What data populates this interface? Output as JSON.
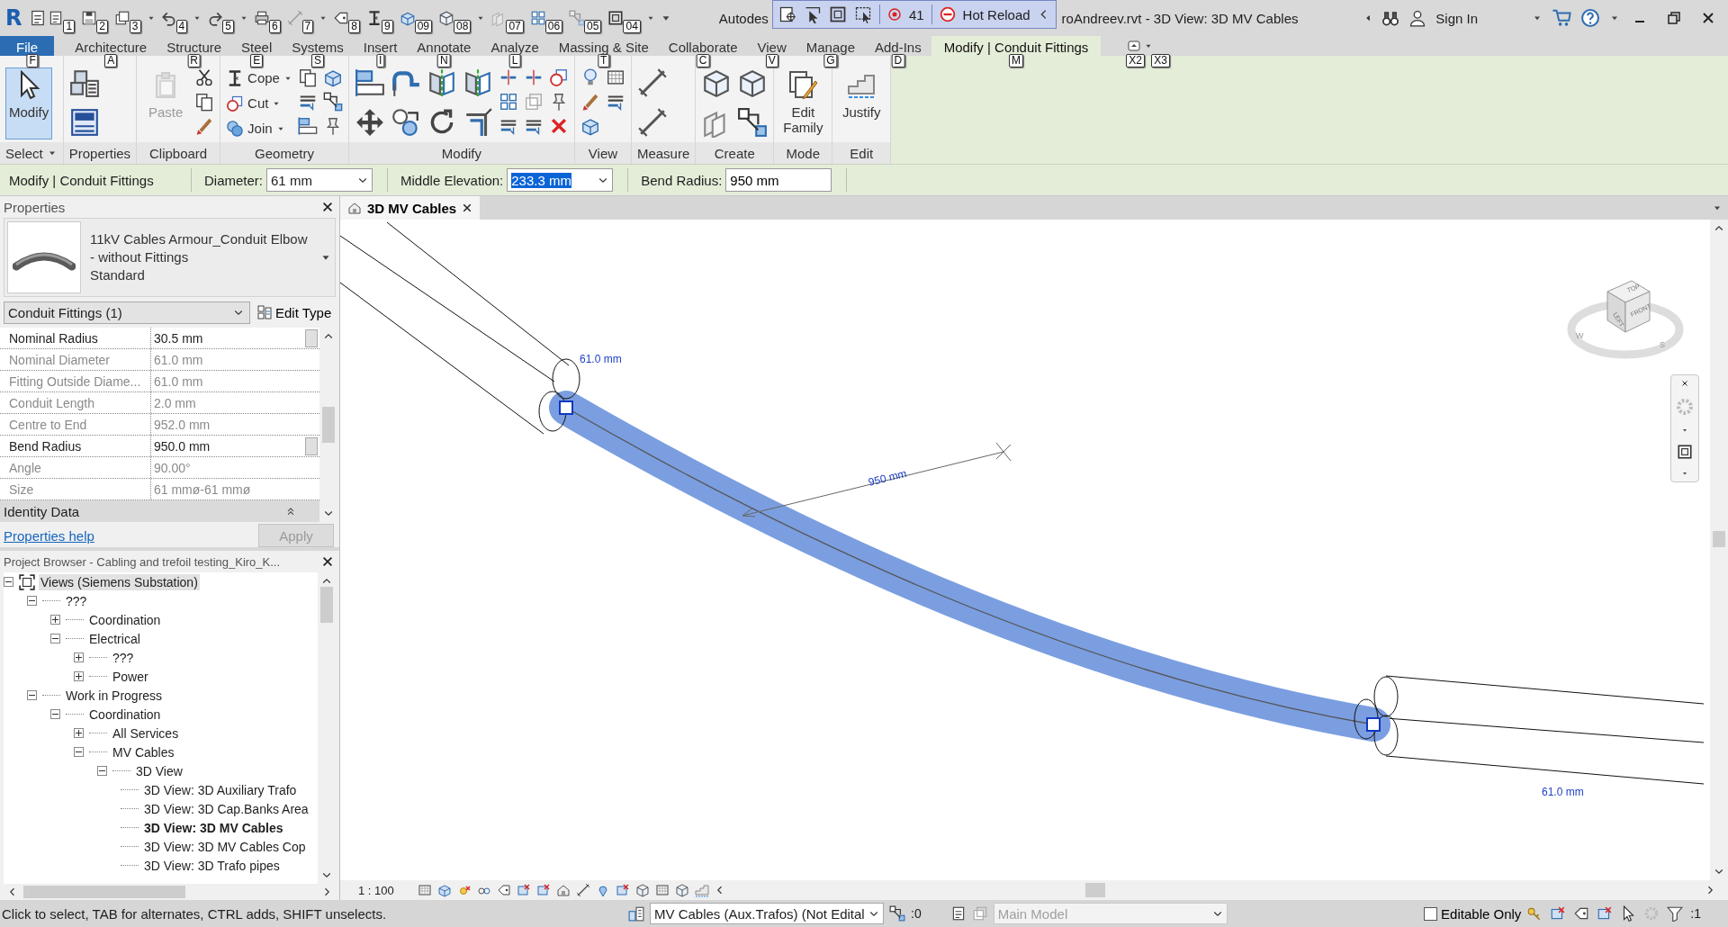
{
  "title_bar": {
    "logo": "R",
    "app_name": "Autodes",
    "file_title": "roAndreev.rvt - 3D View: 3D MV Cables",
    "sign_in": "Sign In"
  },
  "quick_access": [
    {
      "keytip": "1",
      "caret": false,
      "disabled": false
    },
    {
      "keytip": "2",
      "caret": false,
      "disabled": false
    },
    {
      "keytip": "3",
      "caret": true,
      "disabled": false
    },
    {
      "keytip": "4",
      "caret": true,
      "disabled": false
    },
    {
      "keytip": "5",
      "caret": true,
      "disabled": false
    },
    {
      "keytip": "6",
      "caret": false,
      "disabled": false
    },
    {
      "keytip": "7",
      "caret": true,
      "disabled": true
    },
    {
      "keytip": "8",
      "caret": false,
      "disabled": false
    },
    {
      "keytip": "9",
      "caret": false,
      "disabled": false
    },
    {
      "keytip": "09",
      "caret": false,
      "disabled": false
    },
    {
      "keytip": "08",
      "caret": true,
      "disabled": false
    },
    {
      "keytip": "07",
      "caret": false,
      "disabled": true
    },
    {
      "keytip": "06",
      "caret": false,
      "disabled": false
    },
    {
      "keytip": "05",
      "caret": false,
      "disabled": true
    },
    {
      "keytip": "04",
      "caret": true,
      "disabled": false
    }
  ],
  "hot_reload": {
    "count": "41",
    "label": "Hot Reload"
  },
  "ribbon_tabs": [
    {
      "label": "File",
      "keytip": "F",
      "selected": false,
      "kind": "application"
    },
    {
      "label": "Architecture",
      "keytip": "A",
      "selected": false,
      "kind": "tab"
    },
    {
      "label": "Structure",
      "keytip": "R",
      "selected": false,
      "kind": "tab"
    },
    {
      "label": "Steel",
      "keytip": "E",
      "selected": false,
      "kind": "tab"
    },
    {
      "label": "Systems",
      "keytip": "S",
      "selected": false,
      "kind": "tab"
    },
    {
      "label": "Insert",
      "keytip": "I",
      "selected": false,
      "kind": "tab"
    },
    {
      "label": "Annotate",
      "keytip": "N",
      "selected": false,
      "kind": "tab"
    },
    {
      "label": "Analyze",
      "keytip": "L",
      "selected": false,
      "kind": "tab"
    },
    {
      "label": "Massing & Site",
      "keytip": "T",
      "selected": false,
      "kind": "tab"
    },
    {
      "label": "Collaborate",
      "keytip": "C",
      "selected": false,
      "kind": "tab"
    },
    {
      "label": "View",
      "keytip": "V",
      "selected": false,
      "kind": "tab"
    },
    {
      "label": "Manage",
      "keytip": "G",
      "selected": false,
      "kind": "tab"
    },
    {
      "label": "Add-Ins",
      "keytip": "D",
      "selected": false,
      "kind": "tab"
    },
    {
      "label": "Modify | Conduit Fittings",
      "keytip": "M",
      "selected": true,
      "kind": "contextual"
    }
  ],
  "ribbon_keytips": [
    "X2",
    "X3"
  ],
  "ribbon_panels": [
    {
      "title": "Select",
      "has_menu": true,
      "tools": [
        {
          "kind": "large",
          "label": "Modify",
          "selected": true,
          "disabled": false
        }
      ]
    },
    {
      "title": "Properties",
      "has_menu": false
    },
    {
      "title": "Clipboard",
      "has_menu": false,
      "tools": [
        {
          "kind": "large",
          "label": "Paste",
          "selected": false,
          "disabled": true
        }
      ]
    },
    {
      "title": "Geometry",
      "has_menu": false,
      "tools": [
        {
          "kind": "small",
          "label": "Cope"
        },
        {
          "kind": "small",
          "label": "Cut"
        },
        {
          "kind": "small",
          "label": "Join"
        }
      ]
    },
    {
      "title": "Modify",
      "has_menu": false
    },
    {
      "title": "View",
      "has_menu": false
    },
    {
      "title": "Measure",
      "has_menu": false
    },
    {
      "title": "Create",
      "has_menu": false
    },
    {
      "title": "Mode",
      "has_menu": false,
      "tools": [
        {
          "kind": "large",
          "label": "Edit Family",
          "selected": false,
          "disabled": false
        }
      ]
    },
    {
      "title": "Edit",
      "has_menu": false,
      "tools": [
        {
          "kind": "large",
          "label": "Justify",
          "selected": false,
          "disabled": false
        }
      ]
    }
  ],
  "options_bar": {
    "context": "Modify | Conduit Fittings",
    "fields": [
      {
        "label": "Diameter:",
        "value": "61 mm",
        "kind": "combo",
        "highlighted": false
      },
      {
        "label": "Middle Elevation:",
        "value": "233.3 mm",
        "kind": "combo",
        "highlighted": true
      },
      {
        "label": "Bend Radius:",
        "value": "950 mm",
        "kind": "text",
        "highlighted": false
      }
    ]
  },
  "properties": {
    "title": "Properties",
    "type_name": "11kV Cables Armour_Conduit Elbow - without Fittings",
    "type_variant": "Standard",
    "instance_filter": "Conduit Fittings (1)",
    "edit_type": "Edit Type",
    "rows": [
      {
        "name": "Nominal Radius",
        "value": "30.5 mm",
        "disabled": false
      },
      {
        "name": "Nominal Diameter",
        "value": "61.0 mm",
        "disabled": true
      },
      {
        "name": "Fitting Outside Diame...",
        "value": "61.0 mm",
        "disabled": true
      },
      {
        "name": "Conduit Length",
        "value": "2.0 mm",
        "disabled": true
      },
      {
        "name": "Centre to End",
        "value": "952.0 mm",
        "disabled": true
      },
      {
        "name": "Bend Radius",
        "value": "950.0 mm",
        "disabled": false
      },
      {
        "name": "Angle",
        "value": "90.00°",
        "disabled": true
      },
      {
        "name": "Size",
        "value": "61 mmø-61 mmø",
        "disabled": true
      }
    ],
    "group": "Identity Data",
    "help_link": "Properties help",
    "apply": {
      "label": "Apply",
      "disabled": true
    }
  },
  "project_browser": {
    "title": "Project Browser - Cabling and trefoil testing_Kiro_K...",
    "tree": [
      {
        "label": "Views (Siemens Substation)",
        "kind": "root",
        "expanded": true,
        "selected": true,
        "children": [
          {
            "label": "???",
            "kind": "folder",
            "expanded": true,
            "selected": false,
            "children": [
              {
                "label": "Coordination",
                "kind": "folder",
                "expanded": false,
                "selected": false
              },
              {
                "label": "Electrical",
                "kind": "folder",
                "expanded": true,
                "selected": false,
                "children": [
                  {
                    "label": "???",
                    "kind": "folder",
                    "expanded": false,
                    "selected": false
                  },
                  {
                    "label": "Power",
                    "kind": "folder",
                    "expanded": false,
                    "selected": false
                  }
                ]
              }
            ]
          },
          {
            "label": "Work in Progress",
            "kind": "folder",
            "expanded": true,
            "selected": false,
            "children": [
              {
                "label": "Coordination",
                "kind": "folder",
                "expanded": true,
                "selected": false,
                "children": [
                  {
                    "label": "All Services",
                    "kind": "folder",
                    "expanded": false,
                    "selected": false
                  },
                  {
                    "label": "MV Cables",
                    "kind": "folder",
                    "expanded": true,
                    "selected": false,
                    "children": [
                      {
                        "label": "3D View",
                        "kind": "folder",
                        "expanded": true,
                        "selected": false,
                        "children": [
                          {
                            "label": "3D View: 3D Auxiliary Trafo",
                            "kind": "view",
                            "active": false,
                            "selected": false
                          },
                          {
                            "label": "3D View: 3D Cap.Banks Area",
                            "kind": "view",
                            "active": false,
                            "selected": false
                          },
                          {
                            "label": "3D View: 3D MV Cables",
                            "kind": "view",
                            "active": true,
                            "selected": false
                          },
                          {
                            "label": "3D View: 3D MV Cables Cop",
                            "kind": "view",
                            "active": false,
                            "selected": false
                          },
                          {
                            "label": "3D View: 3D Trafo pipes",
                            "kind": "view",
                            "active": false,
                            "selected": false
                          }
                        ]
                      }
                    ]
                  }
                ]
              }
            ]
          }
        ]
      }
    ]
  },
  "view_tab": {
    "label": "3D MV Cables",
    "selected": true
  },
  "canvas": {
    "dimension_labels": [
      "61.0 mm",
      "950 mm",
      "61.0 mm"
    ],
    "viewcube": {
      "faces": [
        "TOP",
        "LEFT",
        "FRONT"
      ],
      "compass": [
        "W",
        "S"
      ]
    }
  },
  "view_control": {
    "scale": "1 : 100"
  },
  "status_bar": {
    "message": "Click to select, TAB for alternates, CTRL adds, SHIFT unselects.",
    "workset": "MV Cables (Aux.Trafos) (Not Edital",
    "workset_count": ":0",
    "design_option": {
      "value": "Main Model",
      "disabled": true
    },
    "editable_only": {
      "label": "Editable Only",
      "checked": false
    },
    "filter_count": ":1"
  }
}
